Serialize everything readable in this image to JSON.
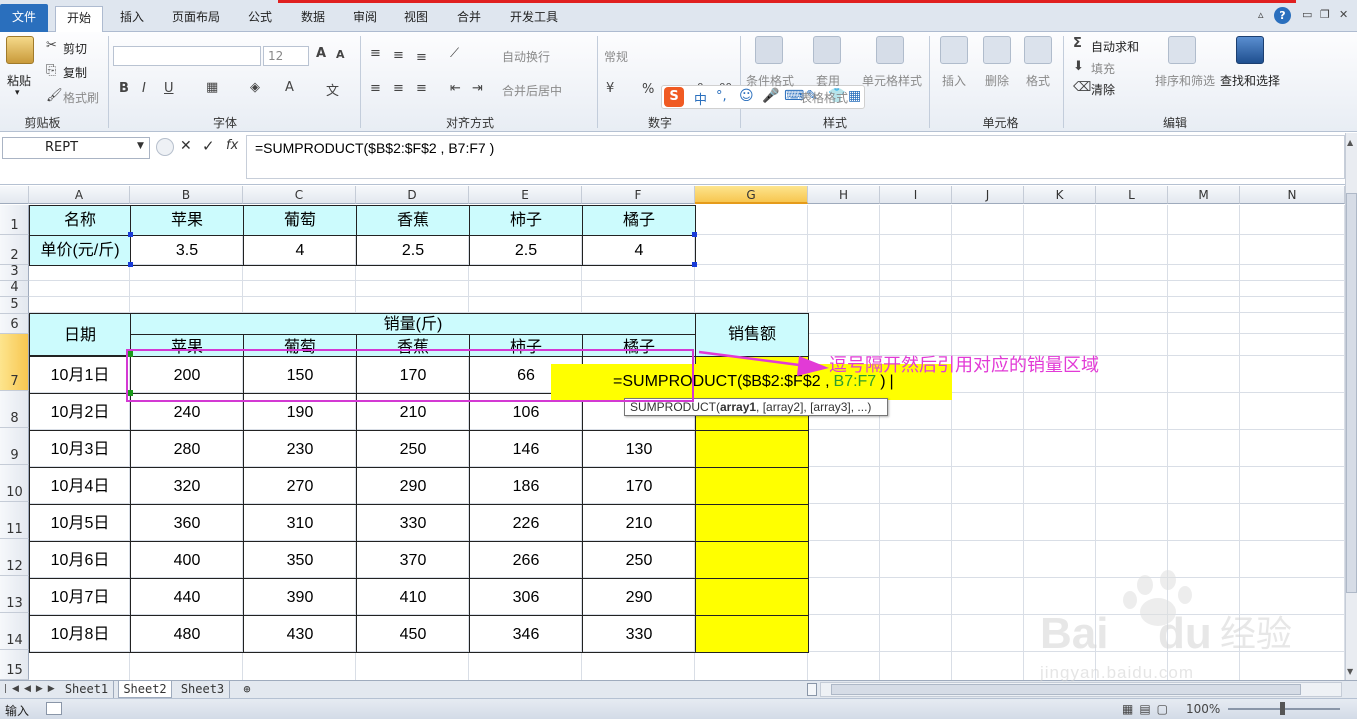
{
  "tabs": [
    "文件",
    "开始",
    "插入",
    "页面布局",
    "公式",
    "数据",
    "审阅",
    "视图",
    "合并",
    "开发工具"
  ],
  "ribbon": {
    "clipboard": {
      "paste": "粘贴",
      "cut": "剪切",
      "copy": "复制",
      "format_painter": "格式刷",
      "label": "剪贴板"
    },
    "font": {
      "name": "",
      "size": "12",
      "label": "字体"
    },
    "alignment": {
      "wrap": "自动换行",
      "merge": "合并后居中",
      "label": "对齐方式"
    },
    "number": {
      "format": "常规",
      "label": "数字"
    },
    "styles": {
      "cond": "条件格式",
      "table": "套用",
      "table2": "表格格式",
      "cell": "单元格样式",
      "label": "样式"
    },
    "cells": {
      "insert": "插入",
      "delete": "删除",
      "format": "格式",
      "label": "单元格"
    },
    "editing": {
      "autosum": "自动求和",
      "fill": "填充",
      "clear": "清除",
      "sort": "排序和筛选",
      "find": "查找和选择",
      "label": "编辑"
    }
  },
  "formula_bar": {
    "name_box": "REPT",
    "formula": "=SUMPRODUCT($B$2:$F$2 , B7:F7 )"
  },
  "columns": [
    "A",
    "B",
    "C",
    "D",
    "E",
    "F",
    "G",
    "H",
    "I",
    "J",
    "K",
    "L",
    "M",
    "N"
  ],
  "rows": [
    "1",
    "2",
    "3",
    "4",
    "5",
    "6",
    "7",
    "8",
    "9",
    "10",
    "11",
    "12",
    "13",
    "14",
    "15"
  ],
  "sheet": {
    "r1": [
      "名称",
      "苹果",
      "葡萄",
      "香蕉",
      "柿子",
      "橘子"
    ],
    "r2": [
      "单价(元/斤)",
      "3.5",
      "4",
      "2.5",
      "2.5",
      "4"
    ],
    "date_hdr": "日期",
    "qty_hdr": "销量(斤)",
    "sales_hdr": "销售额",
    "fruits": [
      "苹果",
      "葡萄",
      "香蕉",
      "柿子",
      "橘子"
    ],
    "data": [
      [
        "10月1日",
        "200",
        "150",
        "170",
        "66",
        ""
      ],
      [
        "10月2日",
        "240",
        "190",
        "210",
        "106",
        ""
      ],
      [
        "10月3日",
        "280",
        "230",
        "250",
        "146",
        "130"
      ],
      [
        "10月4日",
        "320",
        "270",
        "290",
        "186",
        "170"
      ],
      [
        "10月5日",
        "360",
        "310",
        "330",
        "226",
        "210"
      ],
      [
        "10月6日",
        "400",
        "350",
        "370",
        "266",
        "250"
      ],
      [
        "10月7日",
        "440",
        "390",
        "410",
        "306",
        "290"
      ],
      [
        "10月8日",
        "480",
        "430",
        "450",
        "346",
        "330"
      ]
    ]
  },
  "edit_cell": {
    "prefix": "=SUMPRODUCT($B$2:$F$2 ,",
    "ref": "B7:F7",
    "suffix": ")"
  },
  "tooltip": {
    "fn": "SUMPRODUCT(",
    "arg1": "array1",
    "rest": ", [array2], [array3], ...)"
  },
  "annotation": "逗号隔开然后引用对应的销量区域",
  "sheets": [
    "Sheet1",
    "Sheet2",
    "Sheet3"
  ],
  "status": {
    "mode": "输入",
    "zoom": "100%"
  },
  "watermark": {
    "brand": "Bai",
    "brand2": "du",
    "text": "经验",
    "url": "jingyan.baidu.com"
  },
  "colors": {
    "accent": "#2a6fbd",
    "cyan": "#ccfbfd",
    "yellow": "#ffff00",
    "annotation": "#e23ad6",
    "box": "#d339d3"
  }
}
